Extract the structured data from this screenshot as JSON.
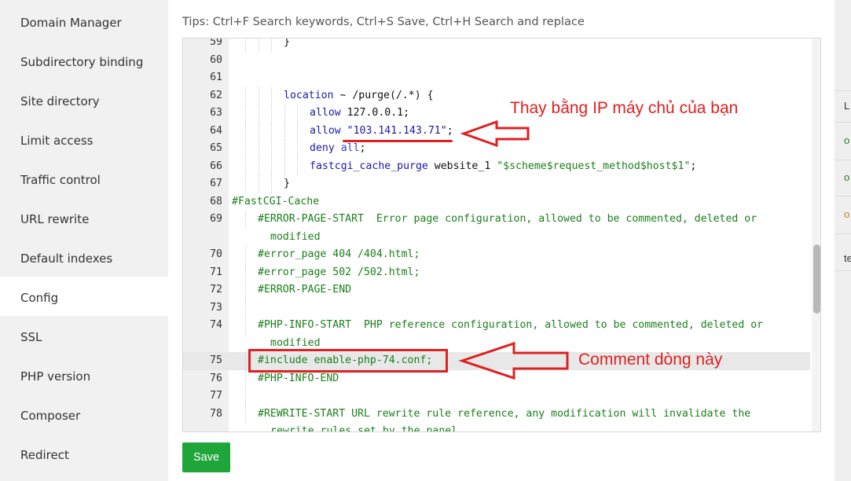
{
  "sidebar": {
    "items": [
      {
        "label": "Domain Manager"
      },
      {
        "label": "Subdirectory binding"
      },
      {
        "label": "Site directory"
      },
      {
        "label": "Limit access"
      },
      {
        "label": "Traffic control"
      },
      {
        "label": "URL rewrite"
      },
      {
        "label": "Default indexes"
      },
      {
        "label": "Config",
        "active": true
      },
      {
        "label": "SSL"
      },
      {
        "label": "PHP version"
      },
      {
        "label": "Composer"
      },
      {
        "label": "Redirect"
      }
    ]
  },
  "main": {
    "tips": "Tips: Ctrl+F Search keywords, Ctrl+S Save, Ctrl+H Search and replace",
    "save_label": "Save"
  },
  "editor": {
    "lines": {
      "l59": {
        "num": "59",
        "text": "}"
      },
      "l60": {
        "num": "60"
      },
      "l61": {
        "num": "61"
      },
      "l62": {
        "num": "62",
        "kw": "location",
        "rest": " ~ /purge(/.*) {"
      },
      "l63": {
        "num": "63",
        "kw": "allow",
        "rest": " 127.0.0.1;"
      },
      "l64": {
        "num": "64",
        "kw": "allow",
        "q1": " \"",
        "ip": "103.141.143.71",
        "q2": "\"",
        "semi": ";"
      },
      "l65": {
        "num": "65",
        "kw": "deny",
        "builtin": "all",
        "semi": ";"
      },
      "l66": {
        "num": "66",
        "kw": "fastcgi_cache_purge",
        "rest": " website_1 ",
        "str": "\"$scheme$request_method$host$1\"",
        "semi": ";"
      },
      "l67": {
        "num": "67",
        "text": "}"
      },
      "l68": {
        "num": "68",
        "text": "#FastCGI-Cache"
      },
      "l69": {
        "num": "69",
        "text": "#ERROR-PAGE-START  Error page configuration, allowed to be commented, deleted or",
        "cont": "modified"
      },
      "l70": {
        "num": "70",
        "text": "#error_page 404 /404.html;"
      },
      "l71": {
        "num": "71",
        "text": "#error_page 502 /502.html;"
      },
      "l72": {
        "num": "72",
        "text": "#ERROR-PAGE-END"
      },
      "l73": {
        "num": "73"
      },
      "l74": {
        "num": "74",
        "text": "#PHP-INFO-START  PHP reference configuration, allowed to be commented, deleted or",
        "cont": "modified"
      },
      "l75": {
        "num": "75",
        "text": "#include enable-php-74.conf;"
      },
      "l76": {
        "num": "76",
        "text": "#PHP-INFO-END"
      },
      "l77": {
        "num": "77"
      },
      "l78": {
        "num": "78",
        "text": "#REWRITE-START URL rewrite rule reference, any modification will invalidate the",
        "cont": "rewrite rules set by the panel"
      }
    }
  },
  "annotations": {
    "ip_note": "Thay bằng IP máy chủ của bạn",
    "comment_note": "Comment dòng này"
  },
  "right_strip": {
    "chars": [
      "L",
      "o",
      "o",
      "o",
      "te"
    ]
  },
  "colors": {
    "accent": "#20a53a",
    "annotation": "#e02020",
    "keyword": "#1a1aa6",
    "comment": "#1a7f1a"
  }
}
